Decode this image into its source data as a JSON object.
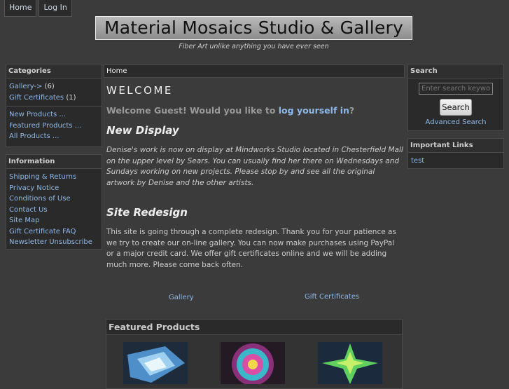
{
  "topnav": {
    "home": "Home",
    "login": "Log In"
  },
  "header": {
    "logo_text": "Material Mosaics Studio & Gallery",
    "tagline": "Fiber Art unlike anything you have ever seen"
  },
  "categories": {
    "title": "Categories",
    "items": [
      {
        "label": "Gallery->",
        "count": "(6)"
      },
      {
        "label": "Gift Certificates",
        "count": "(1)"
      }
    ],
    "extra": [
      "New Products ...",
      "Featured Products ...",
      "All Products ..."
    ]
  },
  "information": {
    "title": "Information",
    "items": [
      "Shipping & Returns",
      "Privacy Notice",
      "Conditions of Use",
      "Contact Us",
      "Site Map",
      "Gift Certificate FAQ",
      "Newsletter Unsubscribe"
    ]
  },
  "search": {
    "title": "Search",
    "placeholder": "Enter search keywords here",
    "button": "Search",
    "advanced": "Advanced Search"
  },
  "important_links": {
    "title": "Important Links",
    "items": [
      "test"
    ]
  },
  "main": {
    "breadcrumb": "Home",
    "welcome": "WELCOME",
    "guest_prefix": "Welcome Guest! Would you like to ",
    "guest_link": "log yourself in",
    "guest_suffix": "?",
    "new_display_title": "New Display",
    "new_display_text": "Denise's work is now on display at Mindworks Studio located in Chesterfield Mall on the upper level by Sears. You can usually find her there on Wednesdays and Sundays working on new projects. Please stop by and see all the original artwork by Denise and the other artists.",
    "redesign_title": "Site Redesign",
    "redesign_text": "This site is going through a complete redesign. Thank you for your patience as we try to create our on-line gallery. You can now make purchases using PayPal or a major credit card. We offer gift certificates online and we will be adding much more. Please come back often.",
    "link_gallery": "Gallery",
    "link_gift": "Gift Certificates",
    "featured_title": "Featured Products"
  },
  "colors": {
    "background": "#3b3b3b",
    "link": "#8fb8e8",
    "panel": "#2a2a2a"
  }
}
